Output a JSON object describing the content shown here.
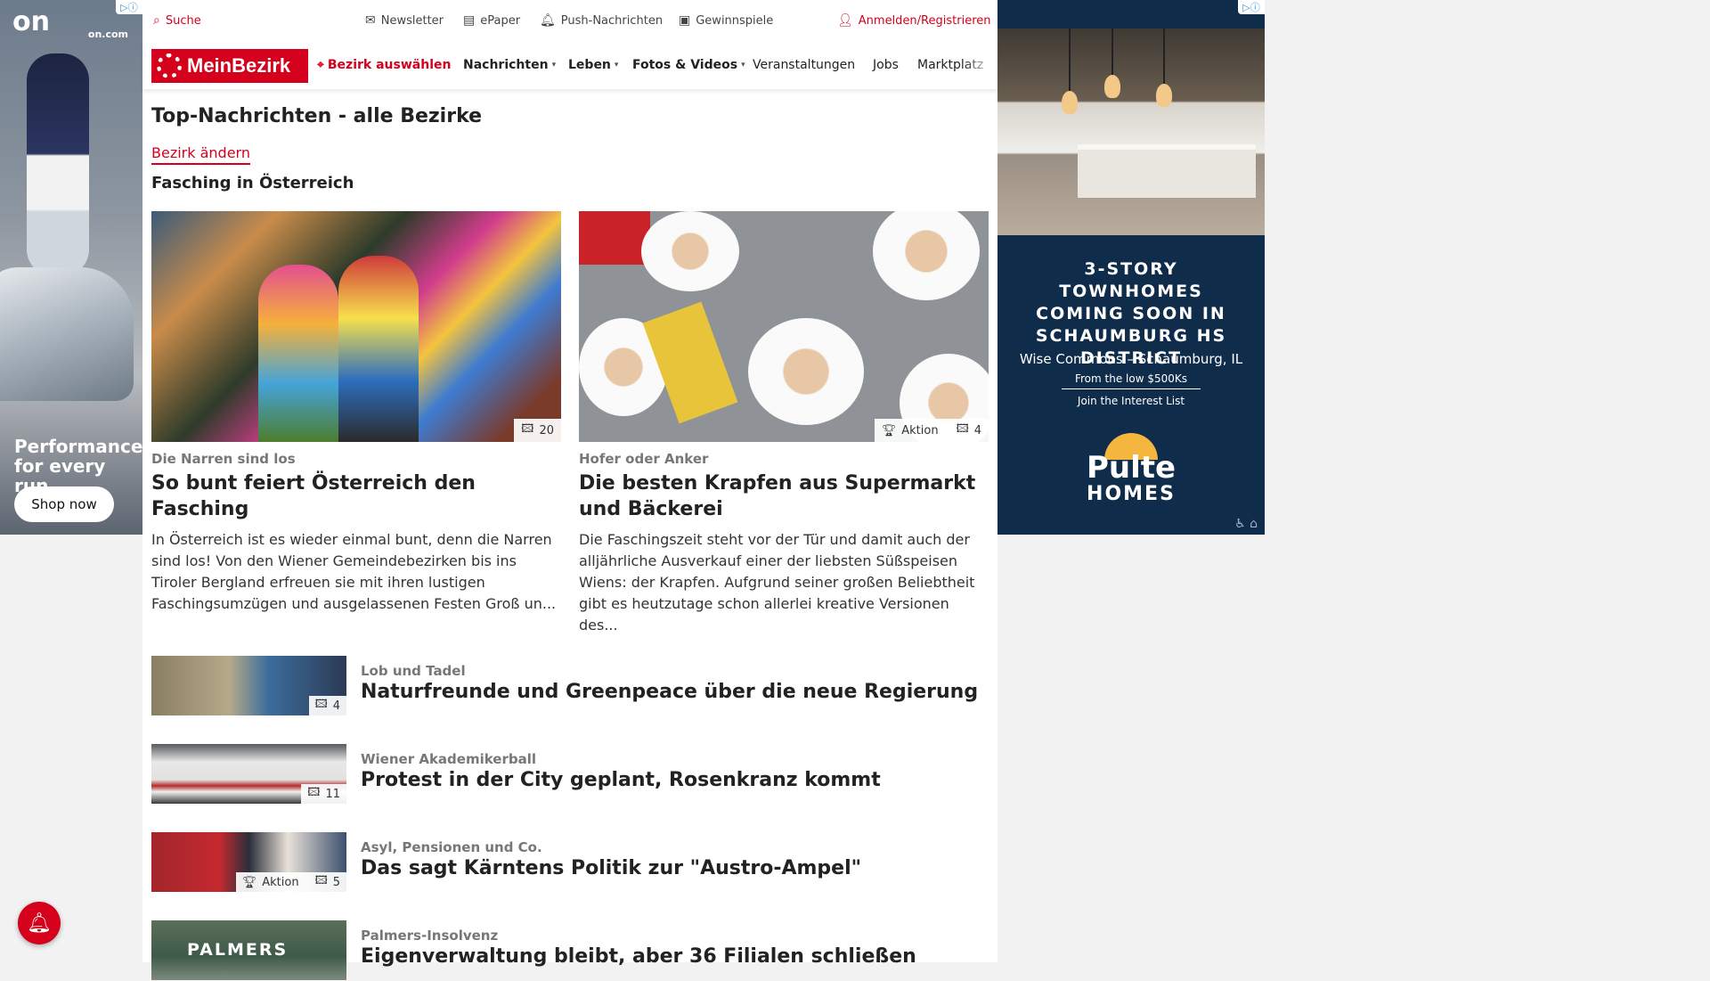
{
  "ad_left": {
    "logo": "on",
    "url": "on.com",
    "tagline": "Performance for every run",
    "cta": "Shop now"
  },
  "topbar": {
    "search": "Suche",
    "newsletter": "Newsletter",
    "epaper": "ePaper",
    "push": "Push-Nachrichten",
    "games": "Gewinnspiele",
    "login": "Anmelden/Registrieren"
  },
  "nav": {
    "brand": "MeinBezirk",
    "bezirk": "Bezirk auswählen",
    "items": [
      "Nachrichten",
      "Leben",
      "Fotos & Videos",
      "Veranstaltungen",
      "Jobs",
      "Marktplatz"
    ]
  },
  "page": {
    "title": "Top-Nachrichten - alle Bezirke",
    "change": "Bezirk ändern",
    "section": "Fasching in Österreich"
  },
  "cards": [
    {
      "kicker": "Die Narren sind los",
      "headline": "So bunt feiert Österreich den Fasching",
      "teaser": "In Österreich ist es wieder einmal bunt, denn die Narren sind los! Von den Wiener Gemeindebezirken bis ins Tiroler Bergland erfreuen sie mit ihren lustigen Faschingsumzügen und ausgelassenen Festen Groß un...",
      "photos": "20"
    },
    {
      "kicker": "Hofer oder Anker",
      "headline": "Die besten Krapfen aus Supermarkt und Bäckerei",
      "teaser": "Die Faschingszeit steht vor der Tür und damit auch der alljährliche Ausverkauf einer der liebsten Süßspeisen Wiens: der Krapfen. Aufgrund seiner großen Beliebtheit gibt es heutzutage schon allerlei kreative Versionen des...",
      "aktion": "Aktion",
      "photos": "4"
    }
  ],
  "list": [
    {
      "kicker": "Lob und Tadel",
      "title": "Naturfreunde und Greenpeace über die neue Regierung",
      "photos": "4"
    },
    {
      "kicker": "Wiener Akademikerball",
      "title": "Protest in der City geplant, Rosenkranz kommt",
      "photos": "11"
    },
    {
      "kicker": "Asyl, Pensionen und Co.",
      "title": "Das sagt Kärntens Politik zur \"Austro-Ampel\"",
      "aktion": "Aktion",
      "photos": "5"
    },
    {
      "kicker": "Palmers-Insolvenz",
      "title": "Eigenverwaltung bleibt, aber 36 Filialen schließen",
      "thumb_text": "PALMERS"
    }
  ],
  "ad_right": {
    "headline": "3-STORY TOWNHOMES COMING SOON IN SCHAUMBURG HS DISTRICT",
    "location": "Wise Commons – Schaumburg, IL",
    "price": "From the low $500Ks",
    "cta": "Join the Interest List",
    "brand_top": "Pulte",
    "brand_bottom": "HOMES"
  }
}
